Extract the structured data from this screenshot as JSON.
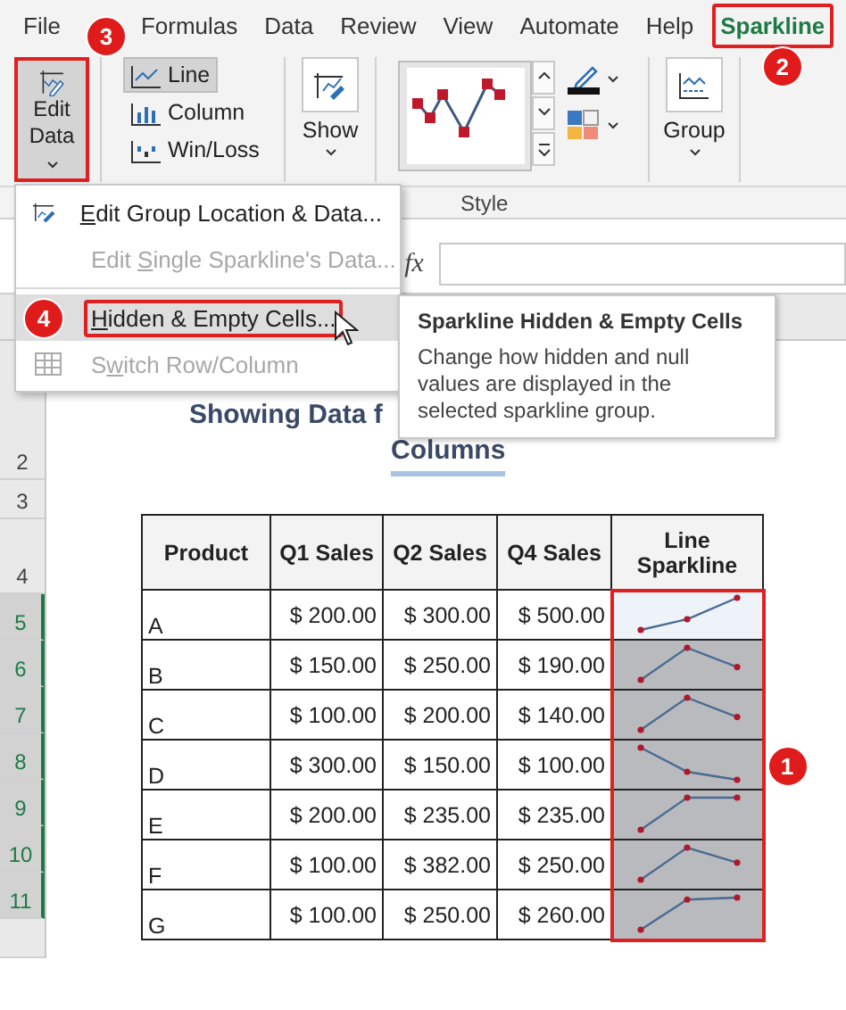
{
  "ribbon_tabs": [
    {
      "label": "File",
      "selected": false
    },
    {
      "label": "Formulas",
      "selected": false
    },
    {
      "label": "Data",
      "selected": false
    },
    {
      "label": "Review",
      "selected": false
    },
    {
      "label": "View",
      "selected": false
    },
    {
      "label": "Automate",
      "selected": false
    },
    {
      "label": "Help",
      "selected": false
    },
    {
      "label": "Sparkline",
      "selected": true,
      "callout": "2"
    }
  ],
  "ribbon": {
    "edit_data": {
      "lines": [
        "Edit",
        "Data"
      ],
      "pressed": true,
      "callout": "3"
    },
    "types": [
      {
        "label": "Line",
        "selected": true
      },
      {
        "label": "Column",
        "selected": false
      },
      {
        "label": "Win/Loss",
        "selected": false
      }
    ],
    "show": "Show",
    "group": "Group",
    "style_label": "Style"
  },
  "edit_menu": [
    {
      "key": "E",
      "suffix": "dit Group Location & Data...",
      "disabled": false,
      "highlighted": false
    },
    {
      "prefix": "Edit ",
      "key": "S",
      "suffix": "ingle Sparkline's Data...",
      "disabled": true,
      "highlighted": false
    },
    {
      "key": "H",
      "suffix": "idden & Empty Cells...",
      "disabled": false,
      "highlighted": true,
      "callout": "4"
    },
    {
      "prefix": "S",
      "key": "w",
      "suffix": "itch Row/Column",
      "disabled": true,
      "highlighted": false
    }
  ],
  "tooltip": {
    "title": "Sparkline Hidden & Empty Cells",
    "text": "Change how hidden and null values are displayed in the selected sparkline group."
  },
  "formula_bar": {
    "fx": "fx"
  },
  "sheet": {
    "title_lines": [
      "Showing Data f",
      "Columns"
    ],
    "row_numbers": [
      "2",
      "3",
      "4",
      "5",
      "6",
      "7",
      "8",
      "9",
      "10",
      "11"
    ],
    "table": {
      "columns": [
        "Product",
        "Q1 Sales",
        "Q2 Sales",
        "Q4 Sales",
        "Line Sparkline"
      ],
      "callout": "1",
      "rows": [
        {
          "cells": [
            "A",
            "$ 200.00",
            "$ 300.00",
            "$ 500.00"
          ],
          "active": true
        },
        {
          "cells": [
            "B",
            "$ 150.00",
            "$ 250.00",
            "$ 190.00"
          ],
          "active": false
        },
        {
          "cells": [
            "C",
            "$ 100.00",
            "$ 200.00",
            "$ 140.00"
          ],
          "active": false
        },
        {
          "cells": [
            "D",
            "$ 300.00",
            "$ 150.00",
            "$ 100.00"
          ],
          "active": false
        },
        {
          "cells": [
            "E",
            "$ 200.00",
            "$ 235.00",
            "$ 235.00"
          ],
          "active": false
        },
        {
          "cells": [
            "F",
            "$ 100.00",
            "$ 382.00",
            "$ 250.00"
          ],
          "active": false
        },
        {
          "cells": [
            "G",
            "$ 100.00",
            "$ 250.00",
            "$ 260.00"
          ],
          "active": false
        }
      ]
    }
  }
}
